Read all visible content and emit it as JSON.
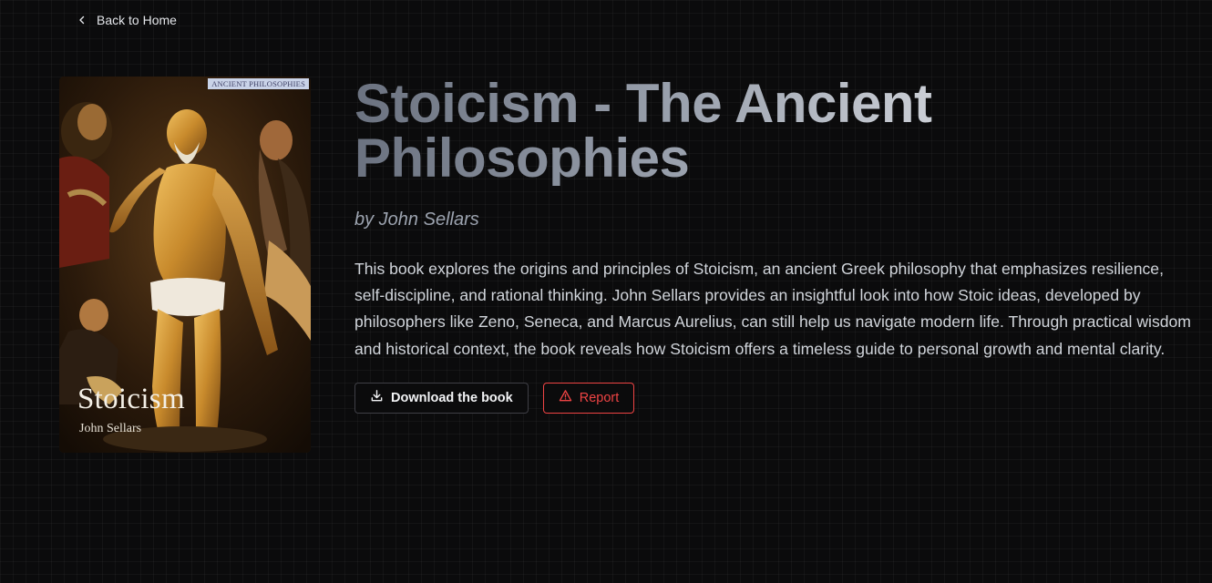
{
  "nav": {
    "back_label": "Back to Home",
    "back_icon": "chevron-left-icon"
  },
  "cover": {
    "series_label": "ANCIENT PHILOSOPHIES",
    "title": "Stoicism",
    "author": "John Sellars"
  },
  "book": {
    "title": "Stoicism - The Ancient Philosophies",
    "author_line": "by John Sellars",
    "description": "This book explores the origins and principles of Stoicism, an ancient Greek philosophy that emphasizes resilience, self-discipline, and rational thinking. John Sellars provides an insightful look into how Stoic ideas, developed by philosophers like Zeno, Seneca, and Marcus Aurelius, can still help us navigate modern life. Through practical wisdom and historical context, the book reveals how Stoicism offers a timeless guide to personal growth and mental clarity."
  },
  "actions": {
    "download_label": "Download the book",
    "download_icon": "download-icon",
    "report_label": "Report",
    "report_icon": "warning-triangle-icon"
  },
  "colors": {
    "background": "#0b0b0c",
    "report_red": "#ef4444",
    "button_border": "#3f3f46"
  }
}
